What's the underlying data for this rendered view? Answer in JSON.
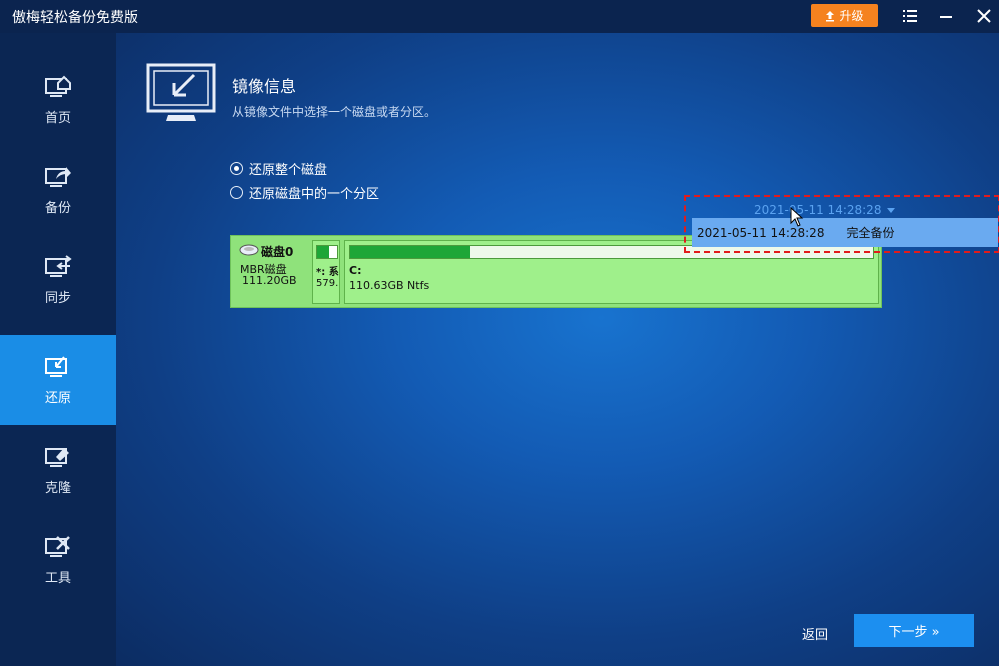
{
  "app": {
    "title": "傲梅轻松备份免费版",
    "upgrade_label": "升级"
  },
  "sidebar": {
    "items": [
      {
        "label": "首页",
        "icon": "home-icon"
      },
      {
        "label": "备份",
        "icon": "backup-icon"
      },
      {
        "label": "同步",
        "icon": "sync-icon"
      },
      {
        "label": "还原",
        "icon": "restore-icon",
        "active": true
      },
      {
        "label": "克隆",
        "icon": "clone-icon"
      },
      {
        "label": "工具",
        "icon": "tools-icon"
      }
    ]
  },
  "page": {
    "title": "镜像信息",
    "subtitle": "从镜像文件中选择一个磁盘或者分区。"
  },
  "options": {
    "restore_whole_disk": "还原整个磁盘",
    "restore_partition": "还原磁盘中的一个分区",
    "selected": "restore_whole_disk"
  },
  "disk": {
    "name": "磁盘0",
    "type": "MBR磁盘",
    "size": "111.20GB",
    "partitions": [
      {
        "label": "*: 系",
        "size": "579.",
        "used_fraction": 0.6
      },
      {
        "label": "C:",
        "size": "110.63GB Ntfs",
        "used_fraction": 0.23
      }
    ]
  },
  "version_dropdown": {
    "selected": "2021-05-11 14:28:28",
    "options": [
      {
        "time": "2021-05-11 14:28:28",
        "type": "完全备份"
      }
    ]
  },
  "footer": {
    "back_label": "返回",
    "next_label": "下一步 »"
  },
  "colors": {
    "accent": "#1a8de6",
    "upgrade": "#f5821f",
    "partition_green": "#8fe27b",
    "highlight_border": "#e21b1b"
  }
}
